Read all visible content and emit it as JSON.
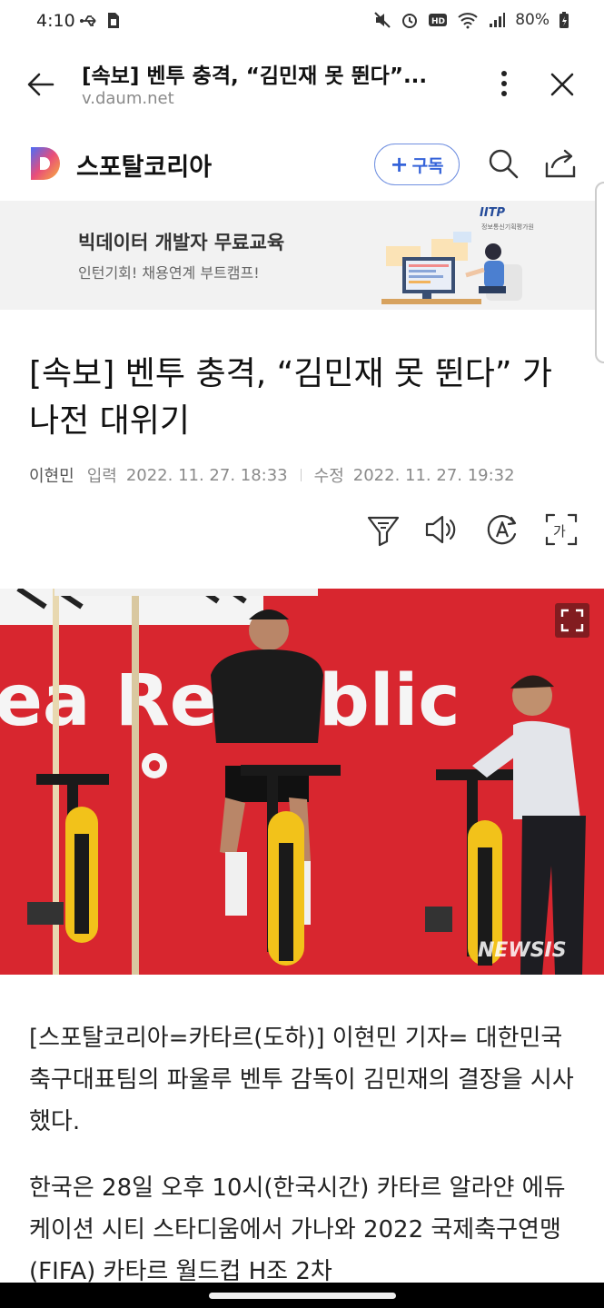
{
  "status_bar": {
    "time": "4:10",
    "battery": "80%"
  },
  "browser": {
    "title": "[속보] 벤투 충격, “김민재 못 뛴다”...",
    "domain": "v.daum.net"
  },
  "channel": {
    "name": "스포탈코리아",
    "subscribe_label": "구독",
    "accent_color": "#3563d9"
  },
  "ad": {
    "title": "빅데이터 개발자 무료교육",
    "subtitle": "인턴기회! 채용연계 부트캠프!",
    "logo": "IITP",
    "logo_sub": "정보통신기획평가원"
  },
  "article": {
    "headline": "[속보] 벤투 충격, “김민재 못 뛴다” 가나전 대위기",
    "author": "이현민",
    "input_label": "입력",
    "input_time": "2022. 11. 27. 18:33",
    "edit_label": "수정",
    "edit_time": "2022. 11. 27. 19:32",
    "photo_credit": "NEWSIS",
    "photo_banner_text": "ea Republic",
    "paragraphs": [
      "[스포탈코리아=카타르(도하)] 이현민 기자= 대한민국 축구대표팀의 파울루 벤투 감독이 김민재의 결장을 시사했다.",
      "한국은 28일 오후 10시(한국시간) 카타르 알라얀 에듀케이션 시티 스타디움에서 가나와 2022 국제축구연맹(FIFA) 카타르 월드컵 H조 2차"
    ]
  },
  "icons": {
    "back": "arrow-left-icon",
    "more": "more-vertical-icon",
    "close": "close-icon",
    "search": "search-icon",
    "share": "share-icon",
    "summary": "summary-filter-icon",
    "tts": "speaker-icon",
    "font": "font-size-icon",
    "translate": "text-scan-icon",
    "expand": "fullscreen-icon"
  }
}
